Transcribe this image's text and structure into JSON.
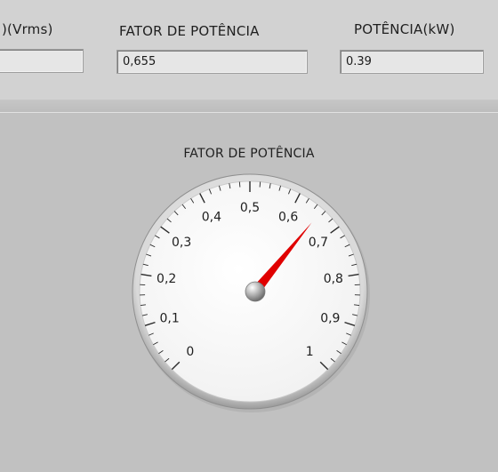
{
  "fields": [
    {
      "label": ")(Vrms)",
      "value": ""
    },
    {
      "label": "FATOR DE POTÊNCIA",
      "value": "0,655"
    },
    {
      "label": "POTÊNCIA(kW)",
      "value": "0.39"
    }
  ],
  "gauge": {
    "title": "FATOR DE POTÊNCIA",
    "value": 0.655,
    "min": 0,
    "max": 1,
    "tick_labels": [
      "0",
      "0,1",
      "0,2",
      "0,3",
      "0,4",
      "0,5",
      "0,6",
      "0,7",
      "0,8",
      "0,9",
      "1"
    ],
    "needle_color": "#e00000"
  }
}
